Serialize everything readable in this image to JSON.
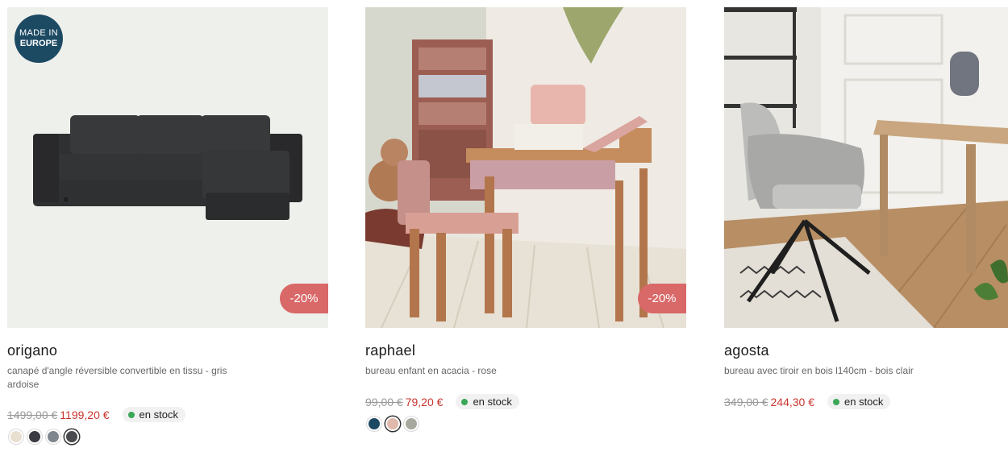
{
  "products": [
    {
      "name": "origano",
      "description": "canapé d'angle réversible convertible en tissu - gris ardoise",
      "badge": "MADE IN EUROPE",
      "badge_line1": "MADE IN",
      "badge_line2": "EUROPE",
      "discount": "-20%",
      "old_price": "1499,00 €",
      "new_price": "1199,20 €",
      "stock": "en stock",
      "swatches": [
        "#e8dfd1",
        "#3a3b42",
        "#7e858c",
        "#4a4b4f"
      ],
      "selected_swatch": 3
    },
    {
      "name": "raphael",
      "description": "bureau enfant en acacia - rose",
      "discount": "-20%",
      "old_price": "99,00 €",
      "new_price": "79,20 €",
      "stock": "en stock",
      "swatches": [
        "#1d4a63",
        "#e0b8ac",
        "#a7a99e"
      ],
      "selected_swatch": 1
    },
    {
      "name": "agosta",
      "description": "bureau avec tiroir en bois l140cm - bois clair",
      "old_price": "349,00 €",
      "new_price": "244,30 €",
      "stock": "en stock"
    }
  ],
  "colors": {
    "accent_price": "#c9352f",
    "discount_badge": "#d96868",
    "made_badge": "#1d4a63",
    "stock_dot": "#3aa757"
  }
}
